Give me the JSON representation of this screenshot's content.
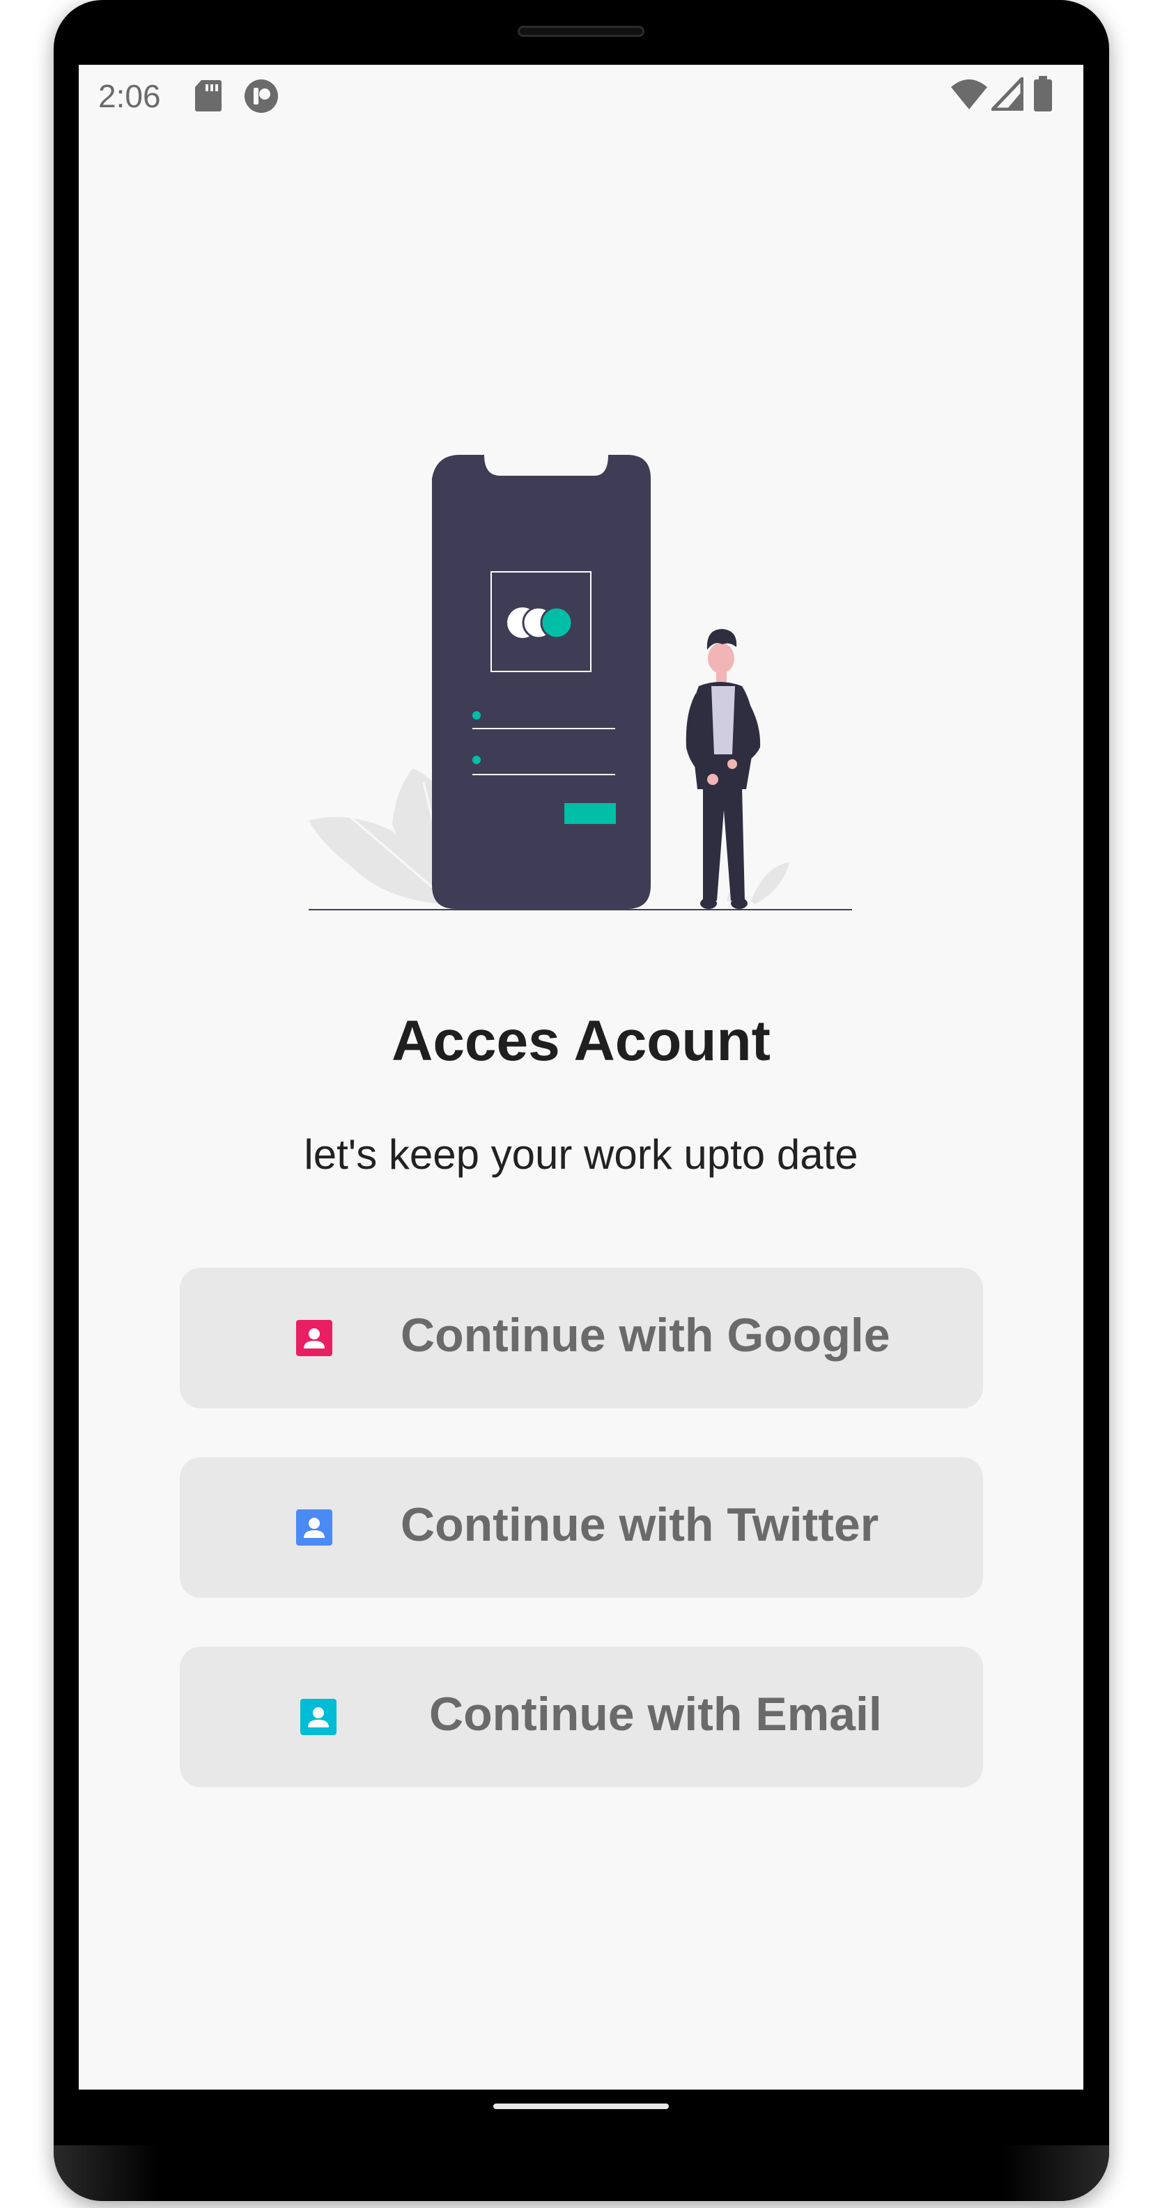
{
  "status_bar": {
    "time": "2:06",
    "icons": [
      "sd-card-icon",
      "sync-icon",
      "wifi-icon",
      "signal-icon",
      "battery-icon"
    ]
  },
  "illustration": {
    "icon_name": "login-illustration",
    "accent_color": "#00bfa6",
    "phone_color": "#3f3d56"
  },
  "main": {
    "title": "Acces Acount",
    "subtitle": "let's keep your work upto date"
  },
  "buttons": [
    {
      "label": "Continue with Google",
      "icon": "account-box-icon",
      "icon_color": "#e91e63"
    },
    {
      "label": "Continue with Twitter",
      "icon": "account-box-icon",
      "icon_color": "#4a8af4"
    },
    {
      "label": "Continue with Email",
      "icon": "account-box-icon",
      "icon_color": "#00bcd4"
    }
  ]
}
